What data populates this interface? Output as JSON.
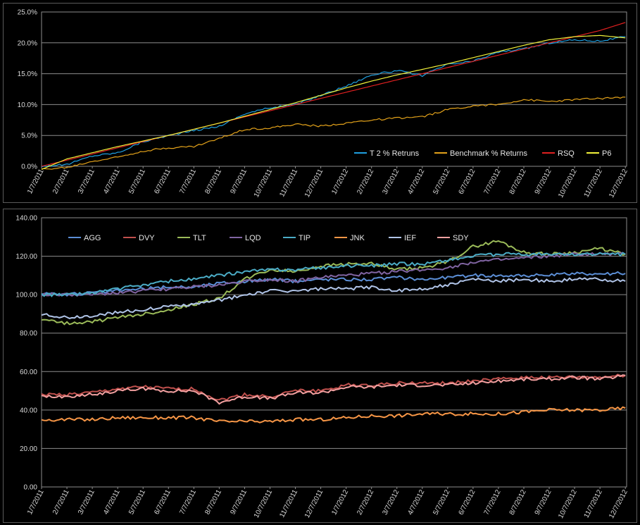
{
  "chart_data": [
    {
      "type": "line",
      "title": "",
      "ylim": [
        0,
        0.25
      ],
      "y_ticks": [
        "0.0%",
        "5.0%",
        "10.0%",
        "15.0%",
        "20.0%",
        "25.0%"
      ],
      "y_tick_values": [
        0,
        0.05,
        0.1,
        0.15,
        0.2,
        0.25
      ],
      "x_tick_labels": [
        "1/7/2011",
        "2/7/2011",
        "3/7/2011",
        "4/7/2011",
        "5/7/2011",
        "6/7/2011",
        "7/7/2011",
        "8/7/2011",
        "9/7/2011",
        "10/7/2011",
        "11/7/2011",
        "12/7/2011",
        "1/7/2012",
        "2/7/2012",
        "3/7/2012",
        "4/7/2012",
        "5/7/2012",
        "6/7/2012",
        "7/7/2012",
        "8/7/2012",
        "9/7/2012",
        "10/7/2012",
        "11/7/2012",
        "12/7/2012"
      ],
      "grid": true,
      "legend": "bottom-right",
      "x": [
        0,
        1,
        2,
        3,
        4,
        5,
        6,
        7,
        8,
        9,
        10,
        11,
        12,
        13,
        14,
        15,
        16,
        17,
        18,
        19,
        20,
        21,
        22,
        23
      ],
      "series": [
        {
          "name": "T 2 % Retruns",
          "color": "#1f9fe0",
          "values": [
            0.0,
            0.003,
            0.017,
            0.022,
            0.04,
            0.05,
            0.058,
            0.065,
            0.085,
            0.095,
            0.1,
            0.115,
            0.13,
            0.148,
            0.155,
            0.147,
            0.165,
            0.17,
            0.185,
            0.19,
            0.2,
            0.205,
            0.203,
            0.21
          ]
        },
        {
          "name": "Benchmark % Returns",
          "color": "#e3a21a",
          "values": [
            -0.005,
            -0.002,
            0.008,
            0.015,
            0.025,
            0.03,
            0.032,
            0.045,
            0.06,
            0.062,
            0.068,
            0.065,
            0.07,
            0.075,
            0.078,
            0.08,
            0.092,
            0.098,
            0.1,
            0.108,
            0.105,
            0.108,
            0.11,
            0.112
          ]
        },
        {
          "name": "RSQ",
          "color": "#e02020",
          "values": [
            0.0,
            0.01,
            0.02,
            0.03,
            0.04,
            0.05,
            0.06,
            0.07,
            0.08,
            0.09,
            0.1,
            0.11,
            0.12,
            0.13,
            0.14,
            0.15,
            0.16,
            0.17,
            0.18,
            0.19,
            0.2,
            0.21,
            0.22,
            0.233
          ]
        },
        {
          "name": "P6",
          "color": "#f2f23a",
          "values": [
            -0.005,
            0.012,
            0.022,
            0.032,
            0.041,
            0.05,
            0.06,
            0.07,
            0.081,
            0.092,
            0.103,
            0.115,
            0.127,
            0.138,
            0.148,
            0.157,
            0.166,
            0.176,
            0.186,
            0.196,
            0.205,
            0.21,
            0.212,
            0.208
          ]
        }
      ]
    },
    {
      "type": "line",
      "title": "",
      "ylim": [
        0,
        140
      ],
      "y_ticks": [
        "0.00",
        "20.00",
        "40.00",
        "60.00",
        "80.00",
        "100.00",
        "120.00",
        "140.00"
      ],
      "y_tick_values": [
        0,
        20,
        40,
        60,
        80,
        100,
        120,
        140
      ],
      "x_tick_labels": [
        "1/7/2011",
        "2/7/2011",
        "3/7/2011",
        "4/7/2011",
        "5/7/2011",
        "6/7/2011",
        "7/7/2011",
        "8/7/2011",
        "9/7/2011",
        "10/7/2011",
        "11/7/2011",
        "12/7/2011",
        "1/7/2012",
        "2/7/2012",
        "3/7/2012",
        "4/7/2012",
        "5/7/2012",
        "6/7/2012",
        "7/7/2012",
        "8/7/2012",
        "9/7/2012",
        "10/7/2012",
        "11/7/2012",
        "12/7/2012"
      ],
      "grid": true,
      "legend": "top",
      "x": [
        0,
        1,
        2,
        3,
        4,
        5,
        6,
        7,
        8,
        9,
        10,
        11,
        12,
        13,
        14,
        15,
        16,
        17,
        18,
        19,
        20,
        21,
        22,
        23
      ],
      "series": [
        {
          "name": "AGG",
          "color": "#5b8ed6",
          "values": [
            101,
            100,
            101,
            102,
            103,
            104,
            104,
            106,
            107,
            108,
            107,
            108,
            108,
            108,
            109,
            108,
            109,
            110,
            110,
            110,
            110,
            111,
            111,
            111
          ]
        },
        {
          "name": "DVY",
          "color": "#c0504d",
          "values": [
            48,
            48,
            49,
            51,
            52,
            51,
            51,
            45,
            48,
            47,
            50,
            50,
            53,
            53,
            54,
            54,
            54,
            55,
            56,
            57,
            57,
            57,
            57,
            58
          ]
        },
        {
          "name": "TLT",
          "color": "#9bbb59",
          "values": [
            87,
            85,
            86,
            88,
            90,
            92,
            95,
            98,
            108,
            113,
            112,
            115,
            116,
            116,
            113,
            114,
            117,
            125,
            128,
            122,
            121,
            122,
            124,
            121
          ]
        },
        {
          "name": "LQD",
          "color": "#8064a2",
          "values": [
            100,
            100,
            100,
            101,
            102,
            103,
            104,
            105,
            107,
            108,
            107,
            109,
            110,
            111,
            112,
            113,
            114,
            117,
            118,
            119,
            120,
            121,
            121,
            121
          ]
        },
        {
          "name": "TIP",
          "color": "#4bacc6",
          "values": [
            100,
            100,
            101,
            103,
            105,
            107,
            108,
            110,
            112,
            113,
            113,
            114,
            115,
            115,
            116,
            116,
            118,
            120,
            121,
            121,
            121,
            121,
            121,
            121
          ]
        },
        {
          "name": "JNK",
          "color": "#f79646",
          "values": [
            35,
            35,
            35,
            36,
            36,
            36,
            36,
            34,
            34,
            34,
            35,
            35,
            36,
            37,
            37,
            38,
            38,
            38,
            38,
            39,
            40,
            40,
            40,
            41
          ]
        },
        {
          "name": "IEF",
          "color": "#b0c4e8",
          "values": [
            90,
            88,
            89,
            91,
            92,
            94,
            95,
            97,
            100,
            102,
            102,
            103,
            103,
            104,
            102,
            103,
            105,
            108,
            107,
            108,
            107,
            108,
            108,
            107
          ]
        },
        {
          "name": "SDY",
          "color": "#f2a0a0",
          "values": [
            47,
            47,
            48,
            50,
            51,
            50,
            50,
            44,
            47,
            46,
            49,
            49,
            52,
            52,
            53,
            53,
            53,
            54,
            55,
            56,
            56,
            57,
            56,
            58
          ]
        }
      ]
    }
  ]
}
